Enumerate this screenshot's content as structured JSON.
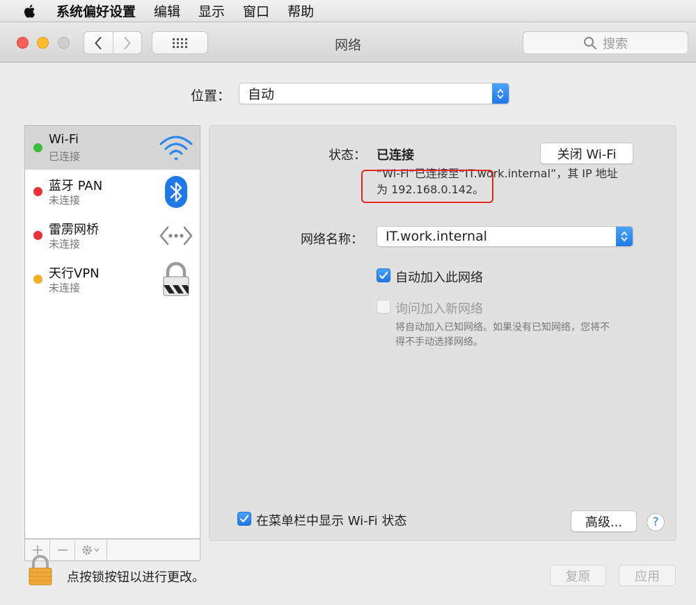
{
  "menubar": {
    "apple_icon": "apple-logo-icon",
    "items": [
      "系统偏好设置",
      "编辑",
      "显示",
      "窗口",
      "帮助"
    ]
  },
  "window": {
    "title": "网络",
    "search_placeholder": "搜索"
  },
  "location": {
    "label": "位置：",
    "value": "自动"
  },
  "services": [
    {
      "name": "Wi-Fi",
      "status": "已连接",
      "dot_color": "#3dbb3e",
      "icon": "wifi-icon",
      "selected": true
    },
    {
      "name": "蓝牙 PAN",
      "status": "未连接",
      "dot_color": "#e8323a",
      "icon": "bluetooth-icon",
      "selected": false
    },
    {
      "name": "雷雳网桥",
      "status": "未连接",
      "dot_color": "#e8323a",
      "icon": "thunderbolt-bridge-icon",
      "selected": false
    },
    {
      "name": "天行VPN",
      "status": "未连接",
      "dot_color": "#f2ad2a",
      "icon": "vpn-lock-icon",
      "selected": false
    }
  ],
  "detail": {
    "status_label": "状态：",
    "status_value": "已连接",
    "wifi_off_button": "关闭 Wi-Fi",
    "status_desc_line1": "“Wi-Fi”已连接至“IT.work.internal”，其 IP 地址",
    "status_desc_line2": "为 192.168.0.142。",
    "network_name_label": "网络名称：",
    "network_name_value": "IT.work.internal",
    "auto_join_label": "自动加入此网络",
    "auto_join_checked": true,
    "ask_join_label": "询问加入新网络",
    "ask_join_checked": false,
    "ask_join_desc_line1": "将自动加入已知网络。如果没有已知网络，您将不",
    "ask_join_desc_line2": "得不手动选择网络。",
    "show_in_menubar_label": "在菜单栏中显示 Wi-Fi 状态",
    "show_in_menubar_checked": true,
    "advanced_button": "高级...",
    "help_button": "?"
  },
  "footer": {
    "lock_text": "点按锁按钮以进行更改。",
    "revert_button": "复原",
    "apply_button": "应用"
  },
  "colors": {
    "accent_blue": "#2f86ef",
    "highlight_red": "#e4261e"
  }
}
